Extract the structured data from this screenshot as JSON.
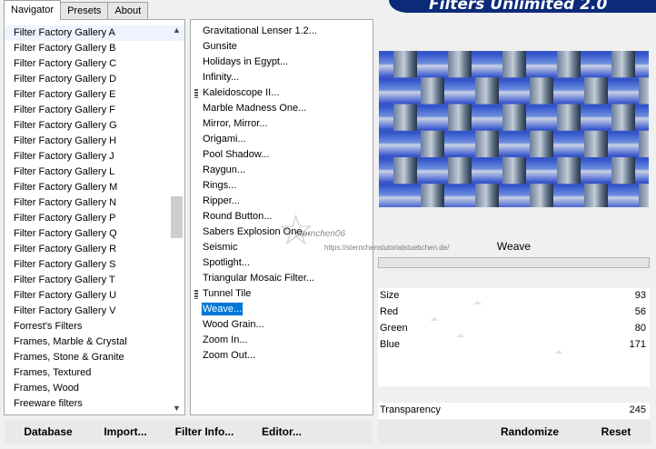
{
  "tabs": [
    {
      "label": "Navigator",
      "active": true
    },
    {
      "label": "Presets",
      "active": false
    },
    {
      "label": "About",
      "active": false
    }
  ],
  "banner": {
    "title": "Filters Unlimited 2.0"
  },
  "categories": [
    "Filter Factory Gallery A",
    "Filter Factory Gallery B",
    "Filter Factory Gallery C",
    "Filter Factory Gallery D",
    "Filter Factory Gallery E",
    "Filter Factory Gallery F",
    "Filter Factory Gallery G",
    "Filter Factory Gallery H",
    "Filter Factory Gallery J",
    "Filter Factory Gallery L",
    "Filter Factory Gallery M",
    "Filter Factory Gallery N",
    "Filter Factory Gallery P",
    "Filter Factory Gallery Q",
    "Filter Factory Gallery R",
    "Filter Factory Gallery S",
    "Filter Factory Gallery T",
    "Filter Factory Gallery U",
    "Filter Factory Gallery V",
    "Forrest's Filters",
    "Frames, Marble & Crystal",
    "Frames, Stone & Granite",
    "Frames, Textured",
    "Frames, Wood",
    "Freeware filters"
  ],
  "filters": [
    {
      "label": "Gravitational Lenser 1.2...",
      "marked": false,
      "selected": false
    },
    {
      "label": "Gunsite",
      "marked": false,
      "selected": false
    },
    {
      "label": "Holidays in Egypt...",
      "marked": false,
      "selected": false
    },
    {
      "label": "Infinity...",
      "marked": false,
      "selected": false
    },
    {
      "label": "Kaleidoscope II...",
      "marked": true,
      "selected": false
    },
    {
      "label": "Marble Madness One...",
      "marked": false,
      "selected": false
    },
    {
      "label": "Mirror, Mirror...",
      "marked": false,
      "selected": false
    },
    {
      "label": "Origami...",
      "marked": false,
      "selected": false
    },
    {
      "label": "Pool Shadow...",
      "marked": false,
      "selected": false
    },
    {
      "label": "Raygun...",
      "marked": false,
      "selected": false
    },
    {
      "label": "Rings...",
      "marked": false,
      "selected": false
    },
    {
      "label": "Ripper...",
      "marked": false,
      "selected": false
    },
    {
      "label": "Round Button...",
      "marked": false,
      "selected": false
    },
    {
      "label": "Sabers Explosion One...",
      "marked": false,
      "selected": false
    },
    {
      "label": "Seismic",
      "marked": false,
      "selected": false
    },
    {
      "label": "Spotlight...",
      "marked": false,
      "selected": false
    },
    {
      "label": "Triangular Mosaic Filter...",
      "marked": false,
      "selected": false
    },
    {
      "label": "Tunnel Tile",
      "marked": true,
      "selected": false
    },
    {
      "label": "Weave...",
      "marked": false,
      "selected": true
    },
    {
      "label": "Wood Grain...",
      "marked": false,
      "selected": false
    },
    {
      "label": "Zoom In...",
      "marked": false,
      "selected": false
    },
    {
      "label": "Zoom Out...",
      "marked": false,
      "selected": false
    }
  ],
  "preview": {
    "colors": {
      "blue": "#3a55c8",
      "grey": "#9aa7b5"
    }
  },
  "watermark": {
    "name": "sternchen06",
    "url": "https://sternchenstutorialstuebchen.de/"
  },
  "filter_name": "Weave",
  "params": [
    {
      "label": "Size",
      "value": "93"
    },
    {
      "label": "Red",
      "value": "56"
    },
    {
      "label": "Green",
      "value": "80"
    },
    {
      "label": "Blue",
      "value": "171"
    }
  ],
  "transparency": {
    "label": "Transparency",
    "value": "245"
  },
  "buttons": {
    "database": "Database",
    "import": "Import...",
    "filter_info": "Filter Info...",
    "editor": "Editor...",
    "randomize": "Randomize",
    "reset": "Reset"
  }
}
